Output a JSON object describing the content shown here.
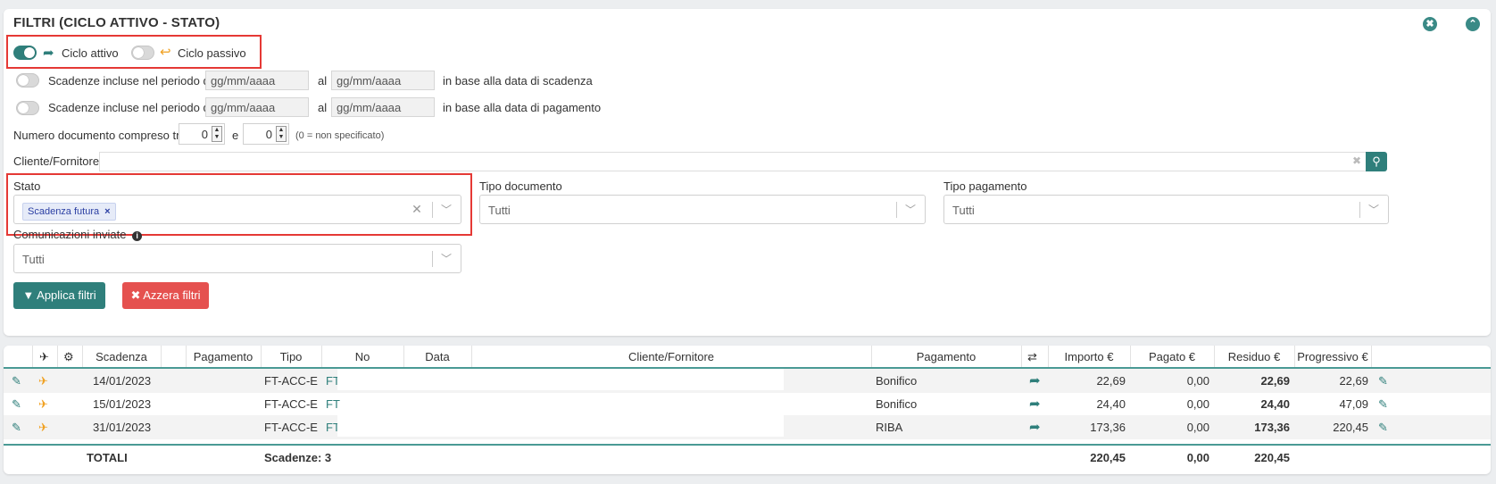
{
  "filters": {
    "title": "FILTRI (CICLO ATTIVO - STATO)",
    "close_icon": "✖",
    "collapse_icon": "⌃",
    "ciclo_attivo": {
      "label": "Ciclo attivo",
      "on": true
    },
    "ciclo_passivo": {
      "label": "Ciclo passivo",
      "on": false
    },
    "scadenza_row": {
      "prefix": "Scadenze incluse nel periodo dal",
      "from_placeholder": "gg/mm/aaaa",
      "sep": "al",
      "to_placeholder": "gg/mm/aaaa",
      "suffix": "in base alla data di scadenza"
    },
    "pagamento_row": {
      "prefix": "Scadenze incluse nel periodo dal",
      "from_placeholder": "gg/mm/aaaa",
      "sep": "al",
      "to_placeholder": "gg/mm/aaaa",
      "suffix": "in base alla data di pagamento"
    },
    "numero": {
      "label": "Numero documento compreso tra",
      "from": "0",
      "sep": "e",
      "to": "0",
      "hint": "(0 = non specificato)"
    },
    "cliente_label": "Cliente/Fornitore",
    "stato": {
      "label": "Stato",
      "chip": "Scadenza futura",
      "chip_remove": "×"
    },
    "tipo_documento": {
      "label": "Tipo documento",
      "value": "Tutti"
    },
    "tipo_pagamento": {
      "label": "Tipo pagamento",
      "value": "Tutti"
    },
    "comunicazioni": {
      "label": "Comunicazioni inviate",
      "value": "Tutti"
    },
    "apply_label": "Applica filtri",
    "reset_label": "Azzera filtri"
  },
  "table": {
    "headers": {
      "scadenza": "Scadenza",
      "pagamento": "Pagamento",
      "tipo": "Tipo",
      "no": "No",
      "data": "Data",
      "cliente": "Cliente/Fornitore",
      "pagamento2": "Pagamento",
      "importo": "Importo €",
      "pagato": "Pagato €",
      "residuo": "Residuo €",
      "progressivo": "Progressivo €"
    },
    "rows": [
      {
        "scadenza": "14/01/2023",
        "tipo": "FT-ACC-E",
        "no": "FT",
        "pagamento": "Bonifico",
        "importo": "22,69",
        "pagato": "0,00",
        "residuo": "22,69",
        "progressivo": "22,69"
      },
      {
        "scadenza": "15/01/2023",
        "tipo": "FT-ACC-E",
        "no": "FT",
        "pagamento": "Bonifico",
        "importo": "24,40",
        "pagato": "0,00",
        "residuo": "24,40",
        "progressivo": "47,09"
      },
      {
        "scadenza": "31/01/2023",
        "tipo": "FT-ACC-E",
        "no": "FT",
        "pagamento": "RIBA",
        "importo": "173,36",
        "pagato": "0,00",
        "residuo": "173,36",
        "progressivo": "220,45"
      }
    ],
    "totals": {
      "label": "TOTALI",
      "count": "Scadenze: 3",
      "importo": "220,45",
      "pagato": "0,00",
      "residuo": "220,45"
    }
  }
}
